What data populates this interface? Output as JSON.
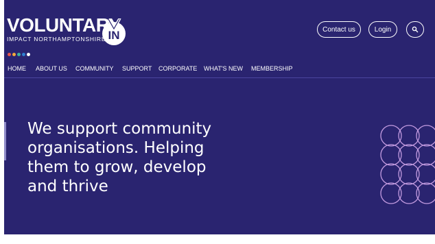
{
  "logo": {
    "wordmark": "VOLUNTARY",
    "subtitle": "IMPACT NORTHAMPTONSHIRE",
    "badge_text": "IN",
    "dot_colors": [
      "#e8584c",
      "#f2a93b",
      "#3bb3a0",
      "#2f7fd1",
      "#ffffff"
    ]
  },
  "header": {
    "contact_label": "Contact us",
    "login_label": "Login",
    "search_icon": "search-icon"
  },
  "nav": {
    "items": [
      {
        "label": "HOME"
      },
      {
        "label": "ABOUT US"
      },
      {
        "label": "COMMUNITY"
      },
      {
        "label": "SUPPORT"
      },
      {
        "label": "CORPORATE"
      },
      {
        "label": "WHAT'S NEW"
      },
      {
        "label": "MEMBERSHIP"
      }
    ]
  },
  "hero": {
    "lines": [
      "We support community",
      "organisations. Helping",
      "them to grow, develop",
      "and thrive"
    ]
  },
  "colors": {
    "background": "#2a2470",
    "accent_pattern": "#c39be0",
    "text": "#ffffff"
  }
}
